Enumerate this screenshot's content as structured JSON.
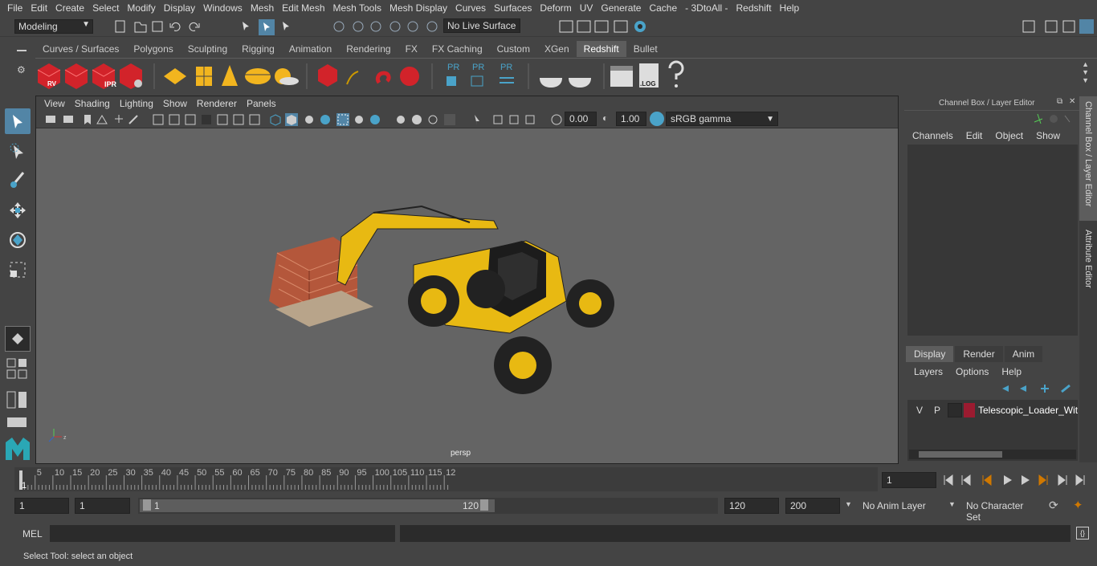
{
  "menubar": [
    "File",
    "Edit",
    "Create",
    "Select",
    "Modify",
    "Display",
    "Windows",
    "Mesh",
    "Edit Mesh",
    "Mesh Tools",
    "Mesh Display",
    "Curves",
    "Surfaces",
    "Deform",
    "UV",
    "Generate",
    "Cache",
    "- 3DtoAll -",
    "Redshift",
    "Help"
  ],
  "status": {
    "mode": "Modeling",
    "live_surface": "No Live Surface"
  },
  "shelf_tabs": [
    "Curves / Surfaces",
    "Polygons",
    "Sculpting",
    "Rigging",
    "Animation",
    "Rendering",
    "FX",
    "FX Caching",
    "Custom",
    "XGen",
    "Redshift",
    "Bullet"
  ],
  "shelf_active": "Redshift",
  "shelf_labels": {
    "rv": "RV",
    "ipr": "IPR",
    "pr": "PR",
    "log": ".LOG"
  },
  "viewport": {
    "menu": [
      "View",
      "Shading",
      "Lighting",
      "Show",
      "Renderer",
      "Panels"
    ],
    "exposure": "0.00",
    "gamma": "1.00",
    "color_space": "sRGB gamma",
    "camera": "persp"
  },
  "channel_box": {
    "title": "Channel Box / Layer Editor",
    "menu": [
      "Channels",
      "Edit",
      "Object",
      "Show"
    ],
    "layer_tabs": [
      "Display",
      "Render",
      "Anim"
    ],
    "layer_tab_active": "Display",
    "layer_menu": [
      "Layers",
      "Options",
      "Help"
    ],
    "layer": {
      "v": "V",
      "p": "P",
      "name": "Telescopic_Loader_With",
      "color": "#9b1b30"
    }
  },
  "side_tabs": [
    "Channel Box / Layer Editor",
    "Attribute Editor"
  ],
  "timeline": {
    "ticks": [
      "5",
      "10",
      "15",
      "20",
      "25",
      "30",
      "35",
      "40",
      "45",
      "50",
      "55",
      "60",
      "65",
      "70",
      "75",
      "80",
      "85",
      "90",
      "95",
      "100",
      "105",
      "110",
      "115",
      "12"
    ],
    "current": "1",
    "start_marker": "1"
  },
  "range": {
    "start": "1",
    "playback_start": "1",
    "slider_start": "1",
    "slider_end": "120",
    "end": "120",
    "anim_end": "200",
    "anim_layer": "No Anim Layer",
    "char_set": "No Character Set"
  },
  "mel": {
    "label": "MEL"
  },
  "help_line": "Select Tool: select an object",
  "colors": {
    "accent": "#5285a6",
    "redshift_red": "#d2232a",
    "loader_yellow": "#e8b912"
  }
}
